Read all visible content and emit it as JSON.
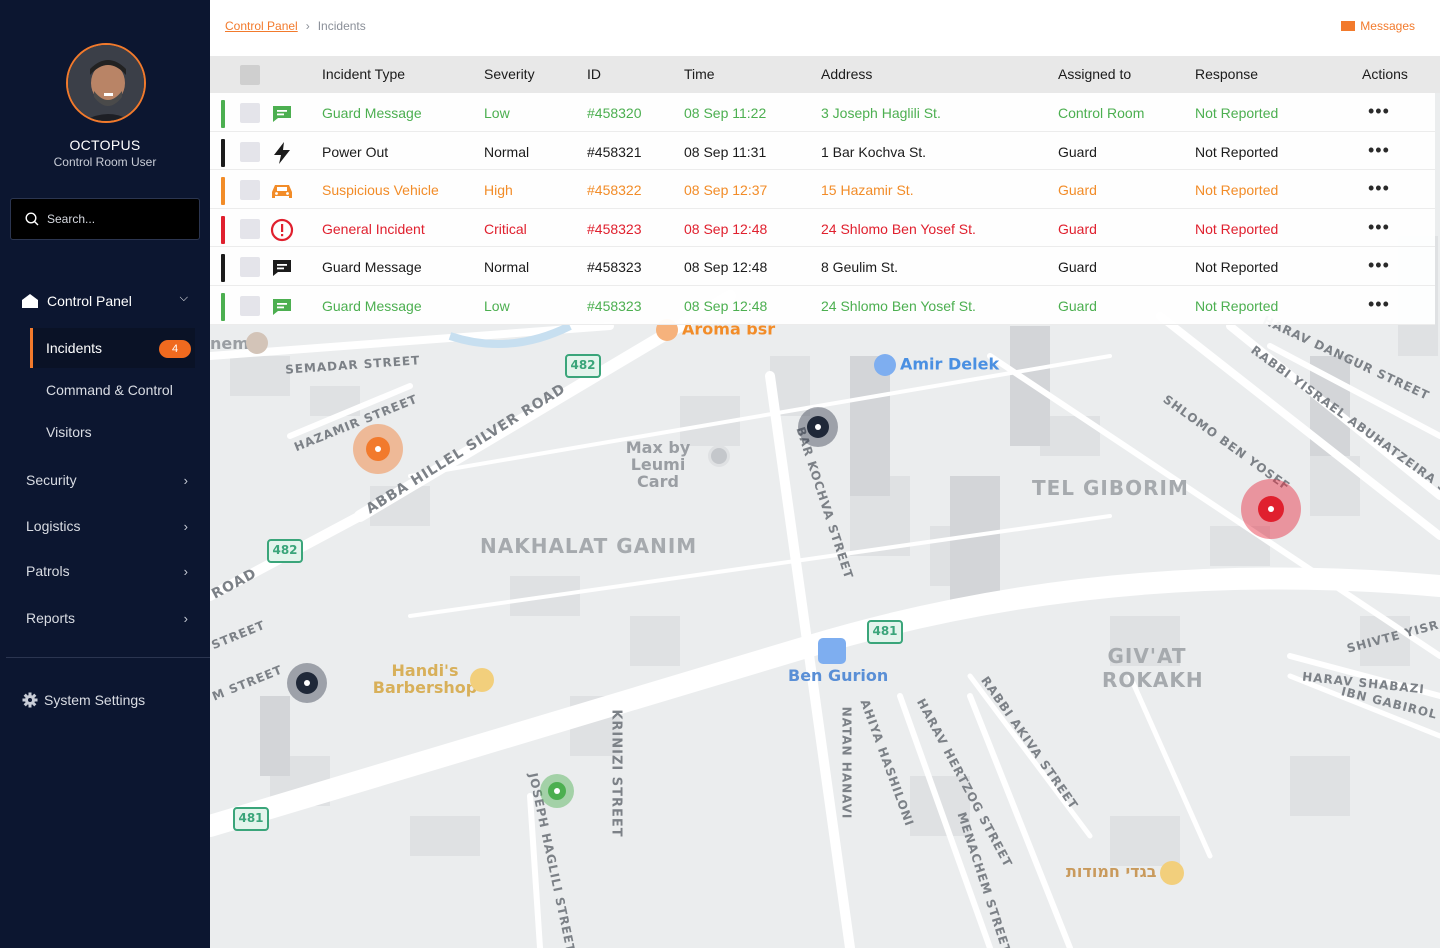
{
  "user": {
    "name": "OCTOPUS",
    "role": "Control Room User"
  },
  "search": {
    "placeholder": "Search..."
  },
  "nav": {
    "control_panel": "Control Panel",
    "incidents": "Incidents",
    "incidents_count": "4",
    "command_control": "Command & Control",
    "visitors": "Visitors",
    "security": "Security",
    "logistics": "Logistics",
    "patrols": "Patrols",
    "reports": "Reports",
    "system_settings": "System Settings"
  },
  "breadcrumb": {
    "root": "Control Panel",
    "current": "Incidents"
  },
  "messages_label": "Messages",
  "colors": {
    "accent": "#f27a2c",
    "low": "#4caf50",
    "high": "#f28c28",
    "critical": "#e0202e",
    "normal": "#1b1b1b"
  },
  "table": {
    "headers": {
      "type": "Incident Type",
      "severity": "Severity",
      "id": "ID",
      "time": "Time",
      "address": "Address",
      "assigned": "Assigned to",
      "response": "Response",
      "actions": "Actions"
    },
    "rows": [
      {
        "icon": "chat-icon",
        "type": "Guard Message",
        "severity": "Low",
        "id": "#458320",
        "time": "08 Sep 11:22",
        "address": "3 Joseph Haglili St.",
        "assigned": "Control Room",
        "response": "Not Reported",
        "color": "#4caf50"
      },
      {
        "icon": "bolt-icon",
        "type": "Power Out",
        "severity": "Normal",
        "id": "#458321",
        "time": "08 Sep 11:31",
        "address": "1 Bar Kochva St.",
        "assigned": "Guard",
        "response": "Not Reported",
        "color": "#1b1b1b"
      },
      {
        "icon": "car-icon",
        "type": "Suspicious Vehicle",
        "severity": "High",
        "id": "#458322",
        "time": "08 Sep 12:37",
        "address": "15 Hazamir St.",
        "assigned": "Guard",
        "response": "Not Reported",
        "color": "#f28c28"
      },
      {
        "icon": "alert-icon",
        "type": "General Incident",
        "severity": "Critical",
        "id": "#458323",
        "time": "08 Sep 12:48",
        "address": "24 Shlomo Ben Yosef St.",
        "assigned": "Guard",
        "response": "Not Reported",
        "color": "#e0202e"
      },
      {
        "icon": "chat-icon",
        "type": "Guard Message",
        "severity": "Normal",
        "id": "#458323",
        "time": "08 Sep 12:48",
        "address": "8 Geulim St.",
        "assigned": "Guard",
        "response": "Not Reported",
        "color": "#1b1b1b"
      },
      {
        "icon": "chat-icon",
        "type": "Guard Message",
        "severity": "Low",
        "id": "#458323",
        "time": "08 Sep 12:48",
        "address": "24 Shlomo Ben Yosef St.",
        "assigned": "Guard",
        "response": "Not Reported",
        "color": "#4caf50"
      }
    ]
  },
  "map": {
    "streets": [
      "SEMADAR STREET",
      "HAZAMIR STREET",
      "ABBA HILLEL SILVER ROAD",
      "BAR KOCHVA STREET",
      "KRINIZI STREET",
      "JOSEPH HAGLILI STREET",
      "HARAV DANGUR STREET",
      "RABBI YISRAEL ABUHATZEIRA STREET",
      "SHLOMO BEN YOSEF",
      "SHIVTE YISRAEL",
      "HARAV SHABAZI",
      "IBN GABIROL",
      "RABBI AKIVA STREET",
      "HARAV HERTZOG STREET",
      "AHIYA HASHILONI",
      "NATAN HANAVI",
      "MENACHEM STREET",
      "ROAD",
      "STREET",
      "M STREET"
    ],
    "districts": [
      "NAKHALAT GANIM",
      "TEL GIBORIM",
      "GIV'AT ROKAKH"
    ],
    "pois": [
      "Aroma bsr",
      "Amir Delek",
      "Max by Leumi Card",
      "Handi's Barbershop",
      "Ben Gurion",
      "בגדי חמודות",
      "nem"
    ],
    "routes": [
      "482",
      "482",
      "481",
      "481"
    ]
  }
}
